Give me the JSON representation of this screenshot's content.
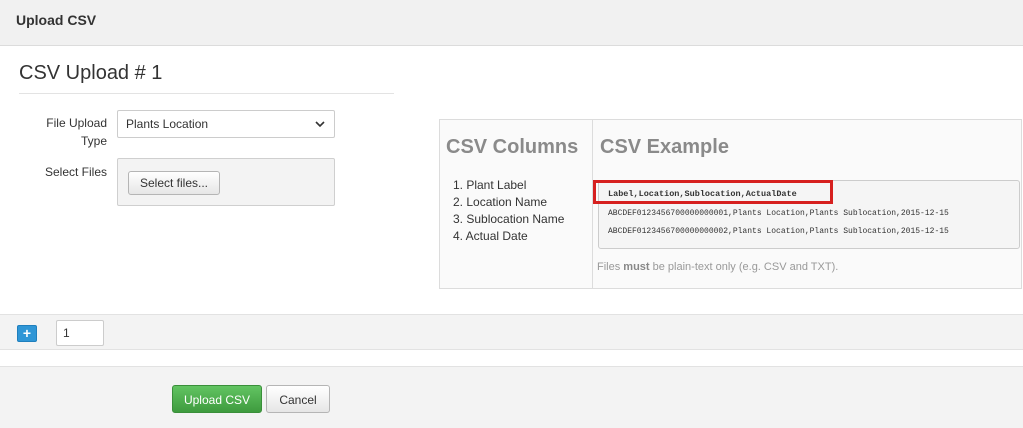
{
  "header": {
    "title": "Upload CSV"
  },
  "upload": {
    "section_title": "CSV Upload # 1",
    "file_type_label": "File Upload Type",
    "file_type_value": "Plants Location",
    "select_files_label": "Select Files",
    "select_files_button": "Select files..."
  },
  "info": {
    "columns_heading": "CSV Columns",
    "example_heading": "CSV Example",
    "columns": [
      "1. Plant Label",
      "2. Location Name",
      "3. Sublocation Name",
      "4. Actual Date"
    ],
    "example_lines": [
      "Label,Location,Sublocation,ActualDate",
      "ABCDEF0123456700000000001,Plants Location,Plants Sublocation,2015-12-15",
      "ABCDEF0123456700000000002,Plants Location,Plants Sublocation,2015-12-15"
    ],
    "note_prefix": "Files",
    "note_bold": "must",
    "note_suffix": "be plain-text only (e.g. CSV and TXT)."
  },
  "add_row": {
    "button_label": "+",
    "count_value": "1"
  },
  "footer": {
    "upload_label": "Upload CSV",
    "cancel_label": "Cancel"
  },
  "colors": {
    "primary_blue": "#2f96d6",
    "success_green": "#4cae4c",
    "highlight_red": "#d6201f"
  }
}
